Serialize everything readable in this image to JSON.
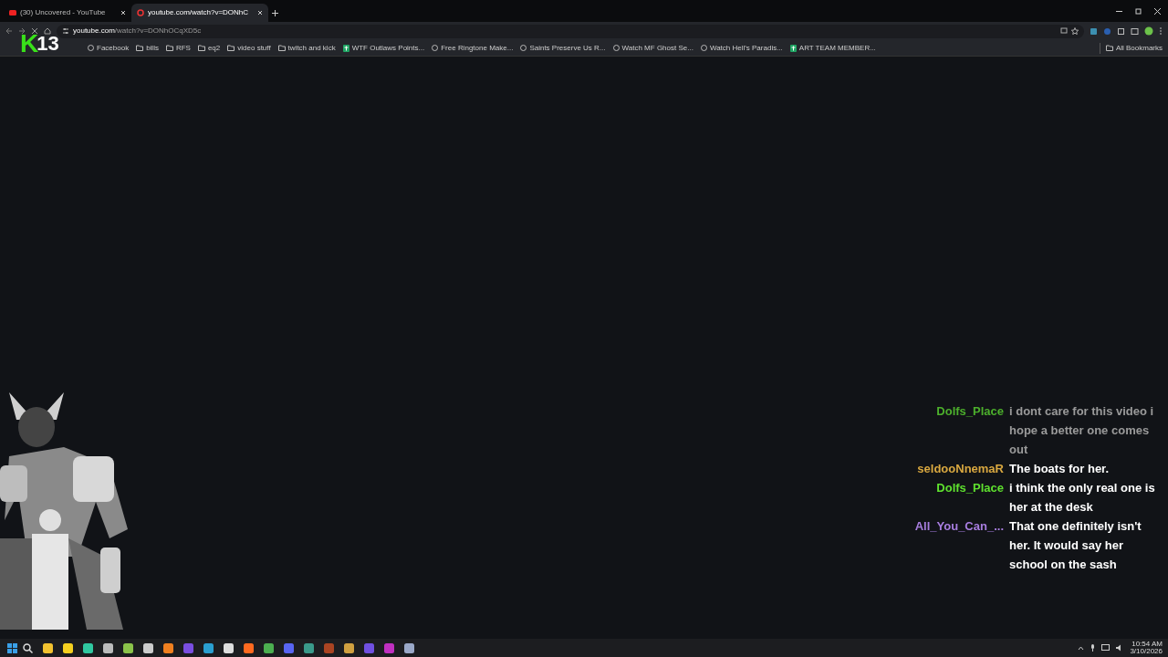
{
  "tabs": [
    {
      "label": "(30) Uncovered - YouTube",
      "selected": false
    },
    {
      "label": "youtube.com/watch?v=DONhC",
      "selected": true
    }
  ],
  "address_bar": {
    "host": "youtube.com",
    "path": "/watch?v=DONhOCqXD5c"
  },
  "bookmarks": [
    {
      "kind": "page",
      "label": "Facebook"
    },
    {
      "kind": "folder",
      "label": "bills"
    },
    {
      "kind": "folder",
      "label": "RFS"
    },
    {
      "kind": "folder",
      "label": "eq2"
    },
    {
      "kind": "folder",
      "label": "video stuff"
    },
    {
      "kind": "folder",
      "label": "twitch and kick"
    },
    {
      "kind": "sheet",
      "label": "WTF Outlaws Points..."
    },
    {
      "kind": "page",
      "label": "Free Ringtone Make..."
    },
    {
      "kind": "page",
      "label": "Saints Preserve Us R..."
    },
    {
      "kind": "page",
      "label": "Watch MF Ghost Se..."
    },
    {
      "kind": "page",
      "label": "Watch Hell's Paradis..."
    },
    {
      "kind": "sheet",
      "label": "ART TEAM MEMBER..."
    }
  ],
  "all_bookmarks": "All Bookmarks",
  "overlay_badge": {
    "letter": "K",
    "number": "13"
  },
  "chat": [
    {
      "user": "Dolfs_Place",
      "color": "#4caf2c",
      "text": "i dont care for this video i hope a better one comes out",
      "dimmed": true
    },
    {
      "user": "seldooNnemaR",
      "color": "#d9a840",
      "text": "The boats for her.",
      "dimmed": false
    },
    {
      "user": "Dolfs_Place",
      "color": "#5ee02e",
      "text": "i think the only real one is her at the desk",
      "dimmed": false
    },
    {
      "user": "All_You_Can_...",
      "color": "#a87ee0",
      "text": "That one definitely isn't her. It would say her school on the sash",
      "dimmed": false
    }
  ],
  "clock": {
    "time": "10:54 AM",
    "date": "3/10/2026"
  }
}
